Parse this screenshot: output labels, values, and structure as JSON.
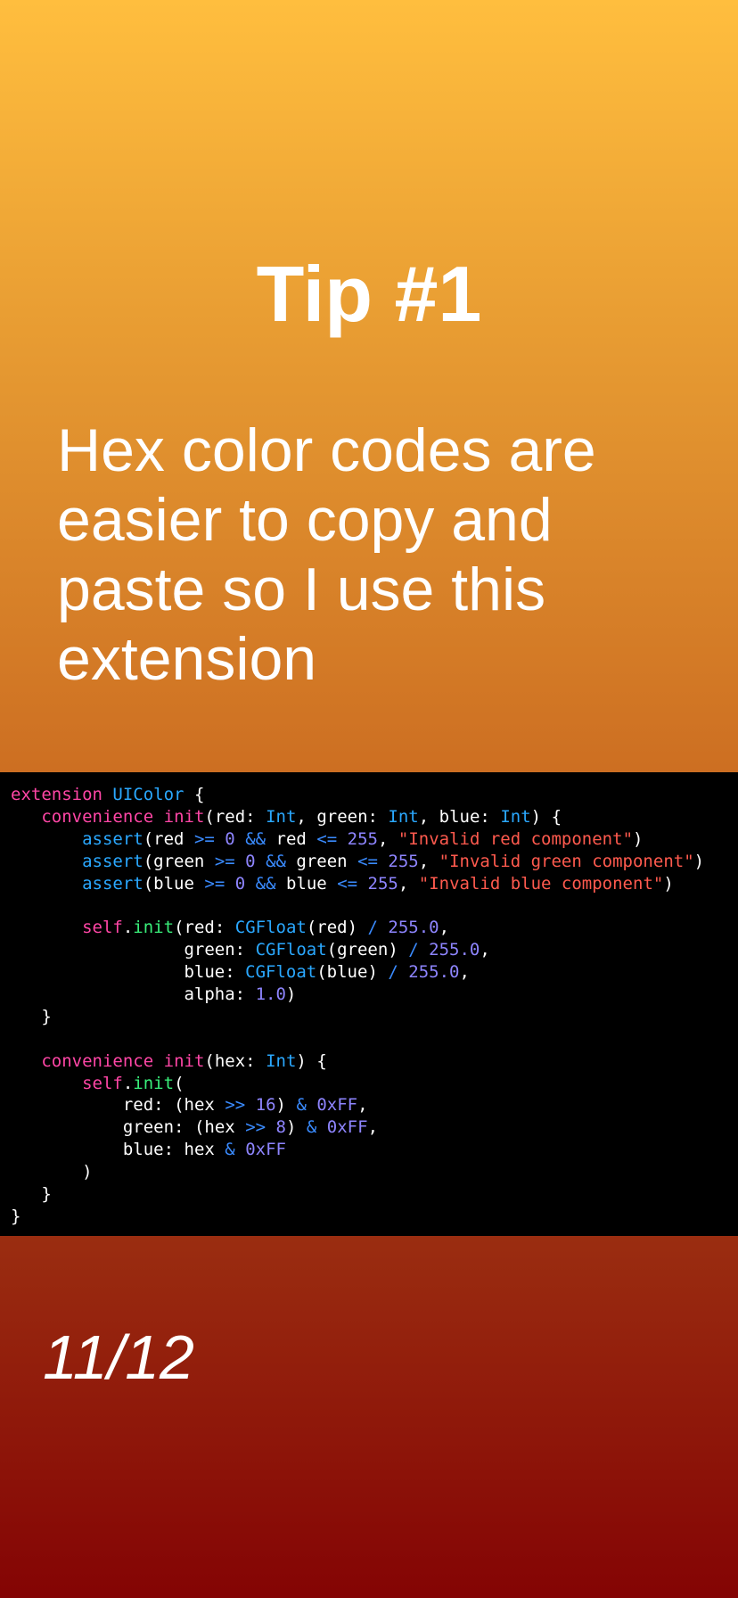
{
  "slide": {
    "title": "Tip #1",
    "subtitle": "Hex color codes are easier to copy and paste so I use this extension",
    "page_indicator": "11/12"
  },
  "code": {
    "language": "swift",
    "lines": [
      "extension UIColor {",
      "   convenience init(red: Int, green: Int, blue: Int) {",
      "       assert(red >= 0 && red <= 255, \"Invalid red component\")",
      "       assert(green >= 0 && green <= 255, \"Invalid green component\")",
      "       assert(blue >= 0 && blue <= 255, \"Invalid blue component\")",
      "",
      "       self.init(red: CGFloat(red) / 255.0,",
      "                 green: CGFloat(green) / 255.0,",
      "                 blue: CGFloat(blue) / 255.0,",
      "                 alpha: 1.0)",
      "   }",
      "",
      "   convenience init(hex: Int) {",
      "       self.init(",
      "           red: (hex >> 16) & 0xFF,",
      "           green: (hex >> 8) & 0xFF,",
      "           blue: hex & 0xFF",
      "       )",
      "   }",
      "}"
    ]
  },
  "colors": {
    "background_top": "#FFBE3E",
    "background_bottom": "#840404",
    "code_background": "#000000",
    "keyword": "#ff46a6",
    "type": "#2aa8ff",
    "operator": "#3a8bff",
    "number": "#8e85ff",
    "string": "#ff5a4e",
    "call": "#39f07a"
  }
}
